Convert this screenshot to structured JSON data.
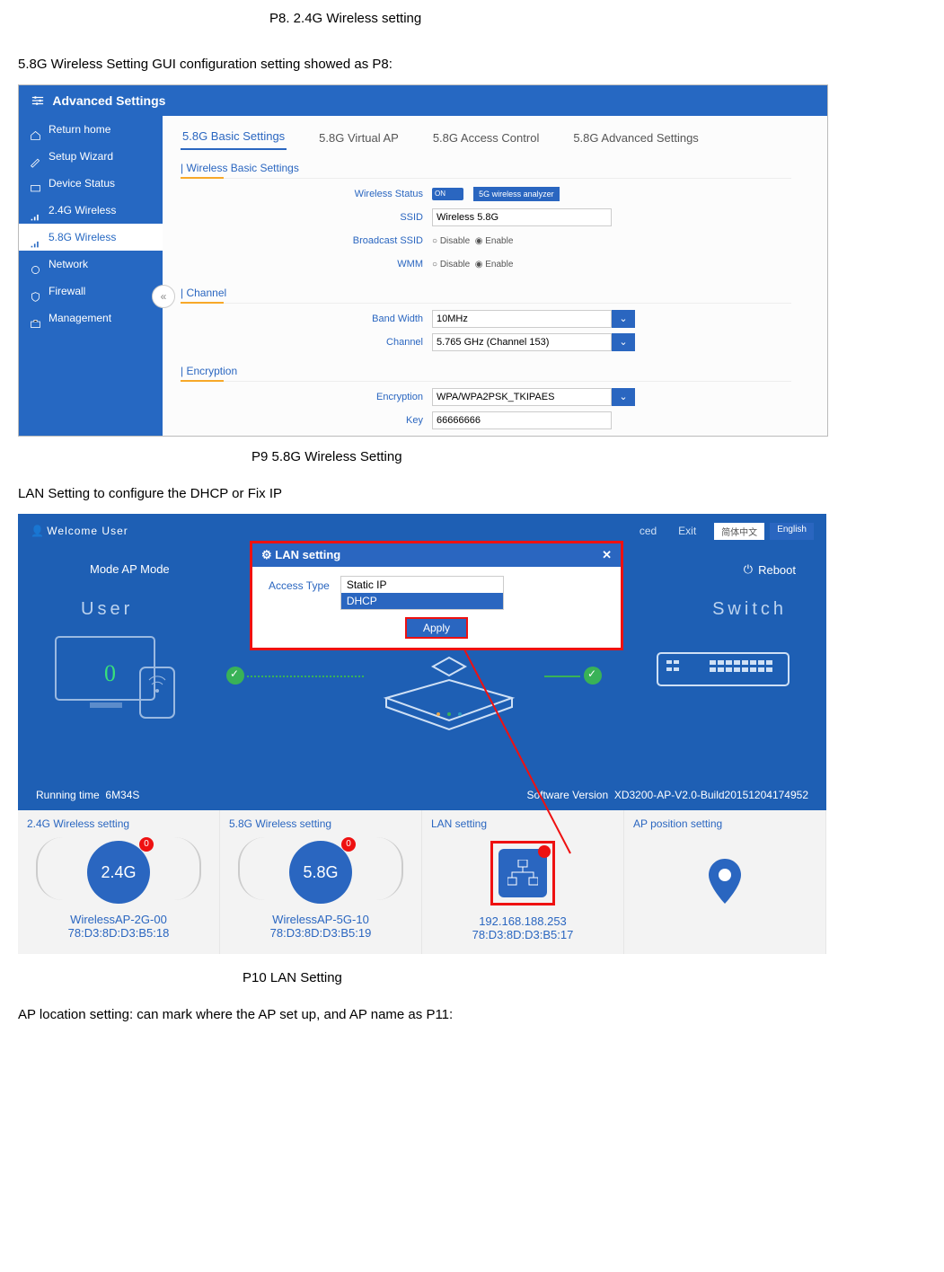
{
  "captions": {
    "p8": "P8. 2.4G Wireless setting",
    "p9": "P9   5.8G Wireless Setting",
    "p10": "P10 LAN Setting"
  },
  "intros": {
    "p9": "5.8G Wireless Setting GUI configuration setting showed as P8:",
    "p10": "LAN Setting to configure the DHCP or Fix IP",
    "p11": "AP location setting: can mark where the AP set up, and AP name as P11:"
  },
  "p9": {
    "header": "Advanced Settings",
    "side": [
      "Return home",
      "Setup Wizard",
      "Device Status",
      "2.4G Wireless",
      "5.8G Wireless",
      "Network",
      "Firewall",
      "Management"
    ],
    "tabs": [
      "5.8G Basic Settings",
      "5.8G Virtual AP",
      "5.8G Access Control",
      "5.8G Advanced Settings"
    ],
    "sections": {
      "basic": "Wireless Basic Settings",
      "channel": "Channel",
      "encryption": "Encryption"
    },
    "labels": {
      "wstatus": "Wireless Status",
      "ssid": "SSID",
      "bcast": "Broadcast SSID",
      "wmm": "WMM",
      "bw": "Band Width",
      "channel": "Channel",
      "enc": "Encryption",
      "key": "Key"
    },
    "values": {
      "toggle": "ON",
      "analyzer": "5G wireless analyzer",
      "ssid": "Wireless 5.8G",
      "radio_disable": "Disable",
      "radio_enable": "Enable",
      "bw": "10MHz",
      "channel": "5.765 GHz (Channel 153)",
      "enc": "WPA/WPA2PSK_TKIPAES",
      "key": "66666666"
    }
  },
  "p10": {
    "welcome": "Welcome User",
    "nav": {
      "advanced": "ced",
      "exit": "Exit"
    },
    "lang": {
      "cn": "简体中文",
      "en": "English"
    },
    "mode": "Mode  AP Mode",
    "reboot": "Reboot",
    "scene": {
      "user": "User",
      "switch": "Switch",
      "count": "0"
    },
    "status": {
      "runtime_label": "Running time",
      "runtime": "6M34S",
      "sw_label": "Software Version",
      "sw": "XD3200-AP-V2.0-Build20151204174952"
    },
    "modal": {
      "title": "LAN setting",
      "access_label": "Access Type",
      "opt_static": "Static IP",
      "opt_dhcp": "DHCP",
      "apply": "Apply",
      "close": "✕"
    },
    "tiles": {
      "t24_title": "2.4G Wireless setting",
      "t24_circle": "2.4G",
      "t24_name": "WirelessAP-2G-00",
      "t24_mac": "78:D3:8D:D3:B5:18",
      "t58_title": "5.8G Wireless setting",
      "t58_circle": "5.8G",
      "t58_name": "WirelessAP-5G-10",
      "t58_mac": "78:D3:8D:D3:B5:19",
      "lan_title": "LAN setting",
      "lan_ip": "192.168.188.253",
      "lan_mac": "78:D3:8D:D3:B5:17",
      "pos_title": "AP position setting",
      "badge": "0"
    }
  }
}
